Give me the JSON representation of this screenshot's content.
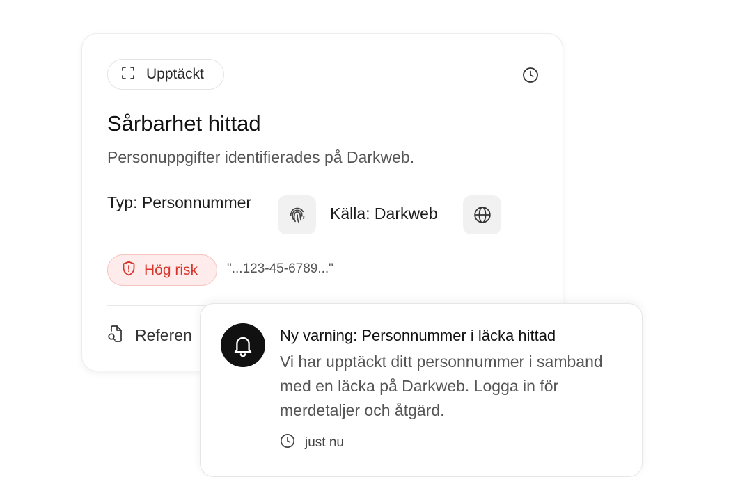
{
  "finding": {
    "chip_label": "Upptäckt",
    "chip_icon": "scan-frame-icon",
    "time_icon": "clock-icon",
    "title": "Sårbarhet hittad",
    "description": "Personuppgifter identifierades på Darkweb.",
    "type_text": "Typ: Personnummer",
    "type_icon": "fingerprint-icon",
    "source_text": "Källa: Darkweb",
    "source_icon": "globe-icon",
    "risk_label": "Hög risk",
    "risk_icon": "shield-alert-icon",
    "risk_color": "#d8362c",
    "snippet": "\"...123-45-6789...\"",
    "reference_label": "Referen",
    "reference_icon": "document-search-icon"
  },
  "notification": {
    "icon": "bell-icon",
    "title": "Ny varning: Personnummer i läcka hittad",
    "body": "Vi har upptäckt ditt personnummer i samband med en läcka på Darkweb. Logga in för merdetaljer och åtgärd.",
    "time_icon": "clock-icon",
    "time": "just nu"
  }
}
